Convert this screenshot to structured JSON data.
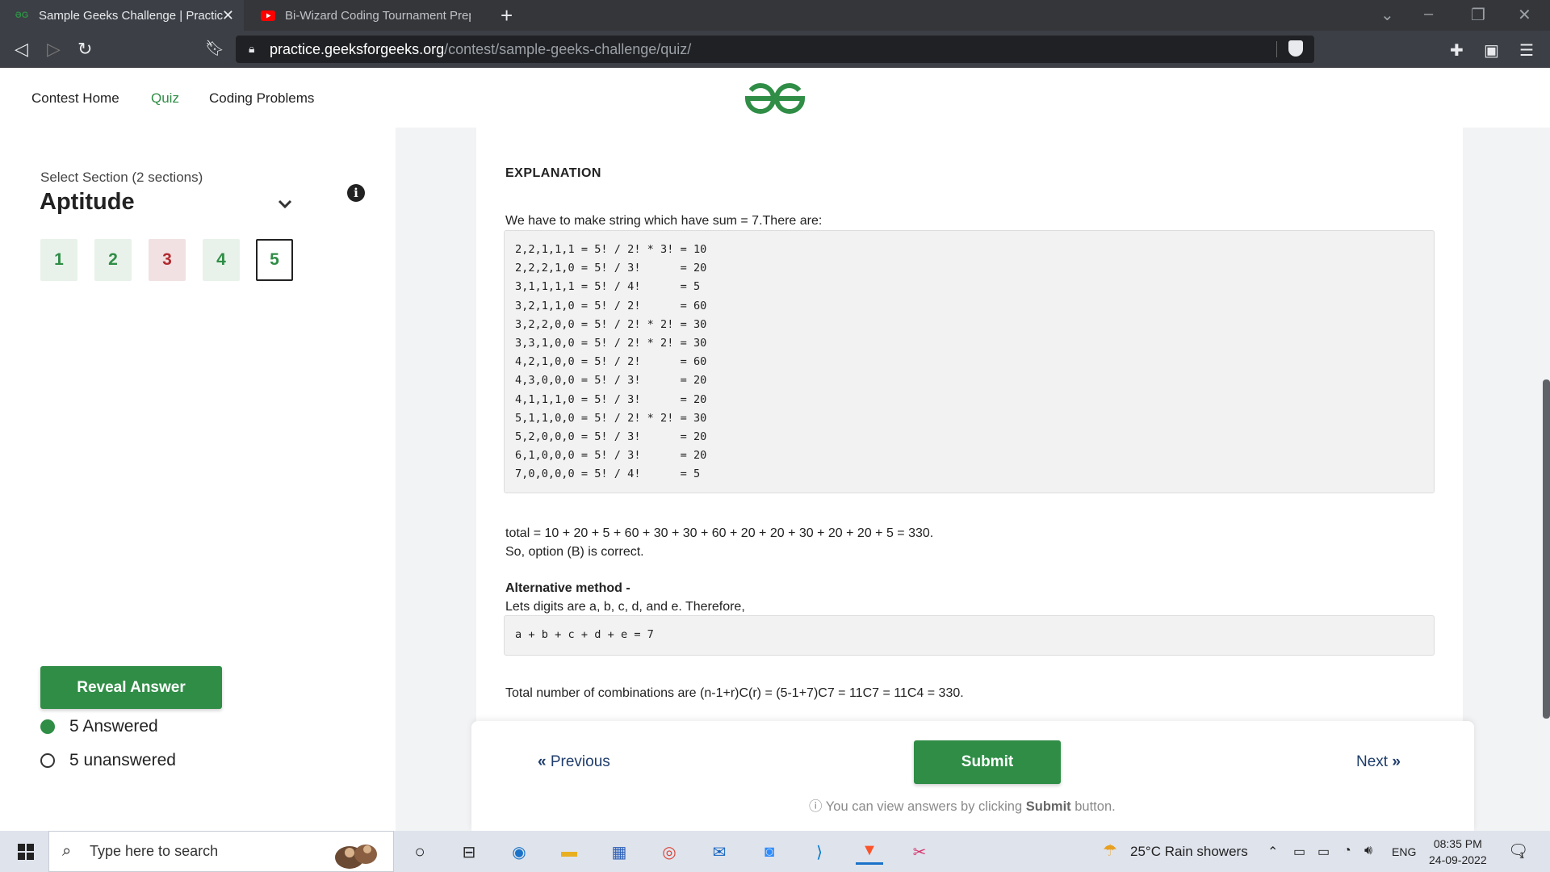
{
  "browser": {
    "tabs": [
      {
        "title": "Sample Geeks Challenge | Practic",
        "active": true
      },
      {
        "title": "Bi-Wizard Coding Tournament Prepara",
        "active": false
      }
    ],
    "url_host": "practice.geeksforgeeks.org",
    "url_path": "/contest/sample-geeks-challenge/quiz/"
  },
  "header": {
    "nav": [
      "Contest Home",
      "Quiz",
      "Coding Problems"
    ],
    "active_nav": "Quiz",
    "brand_color": "#2f8d46"
  },
  "sidebar": {
    "section_label": "Select Section (2 sections)",
    "section_name": "Aptitude",
    "questions": [
      {
        "num": "1",
        "state": "answered"
      },
      {
        "num": "2",
        "state": "answered"
      },
      {
        "num": "3",
        "state": "wrong"
      },
      {
        "num": "4",
        "state": "answered"
      },
      {
        "num": "5",
        "state": "current"
      }
    ],
    "reveal_label": "Reveal Answer",
    "answered_text": "5 Answered",
    "unanswered_text": "5 unanswered"
  },
  "explanation": {
    "title": "EXPLANATION",
    "intro": "We have to make string which have sum = 7.There are:",
    "code_lines": [
      "2,2,1,1,1 = 5! / 2! * 3! = 10",
      "2,2,2,1,0 = 5! / 3!      = 20",
      "3,1,1,1,1 = 5! / 4!      = 5",
      "3,2,1,1,0 = 5! / 2!      = 60",
      "3,2,2,0,0 = 5! / 2! * 2! = 30",
      "3,3,1,0,0 = 5! / 2! * 2! = 30",
      "4,2,1,0,0 = 5! / 2!      = 60",
      "4,3,0,0,0 = 5! / 3!      = 20",
      "4,1,1,1,0 = 5! / 3!      = 20",
      "5,1,1,0,0 = 5! / 2! * 2! = 30",
      "5,2,0,0,0 = 5! / 3!      = 20",
      "6,1,0,0,0 = 5! / 3!      = 20",
      "7,0,0,0,0 = 5! / 4!      = 5"
    ],
    "total": "total = 10 + 20 + 5 + 60 + 30 + 30 + 60 + 20 + 20 + 30 + 20 + 20 + 5 = 330.",
    "conclusion": "So, option (B) is correct.",
    "alt_title": "Alternative method -",
    "alt_intro": "Lets digits are a, b, c, d, and e. Therefore,",
    "alt_code": "a + b + c + d + e = 7",
    "combinations": "Total number of combinations are (n-1+r)C(r) = (5-1+7)C7 = 11C7 = 11C4 = 330."
  },
  "footer": {
    "previous": "Previous",
    "submit": "Submit",
    "next": "Next",
    "hint_prefix": "You can view answers by clicking ",
    "hint_bold": "Submit",
    "hint_suffix": " button."
  },
  "taskbar": {
    "search_placeholder": "Type here to search",
    "weather": "25°C  Rain showers",
    "lang": "ENG",
    "time": "08:35 PM",
    "date": "24-09-2022",
    "notifications": "1"
  }
}
